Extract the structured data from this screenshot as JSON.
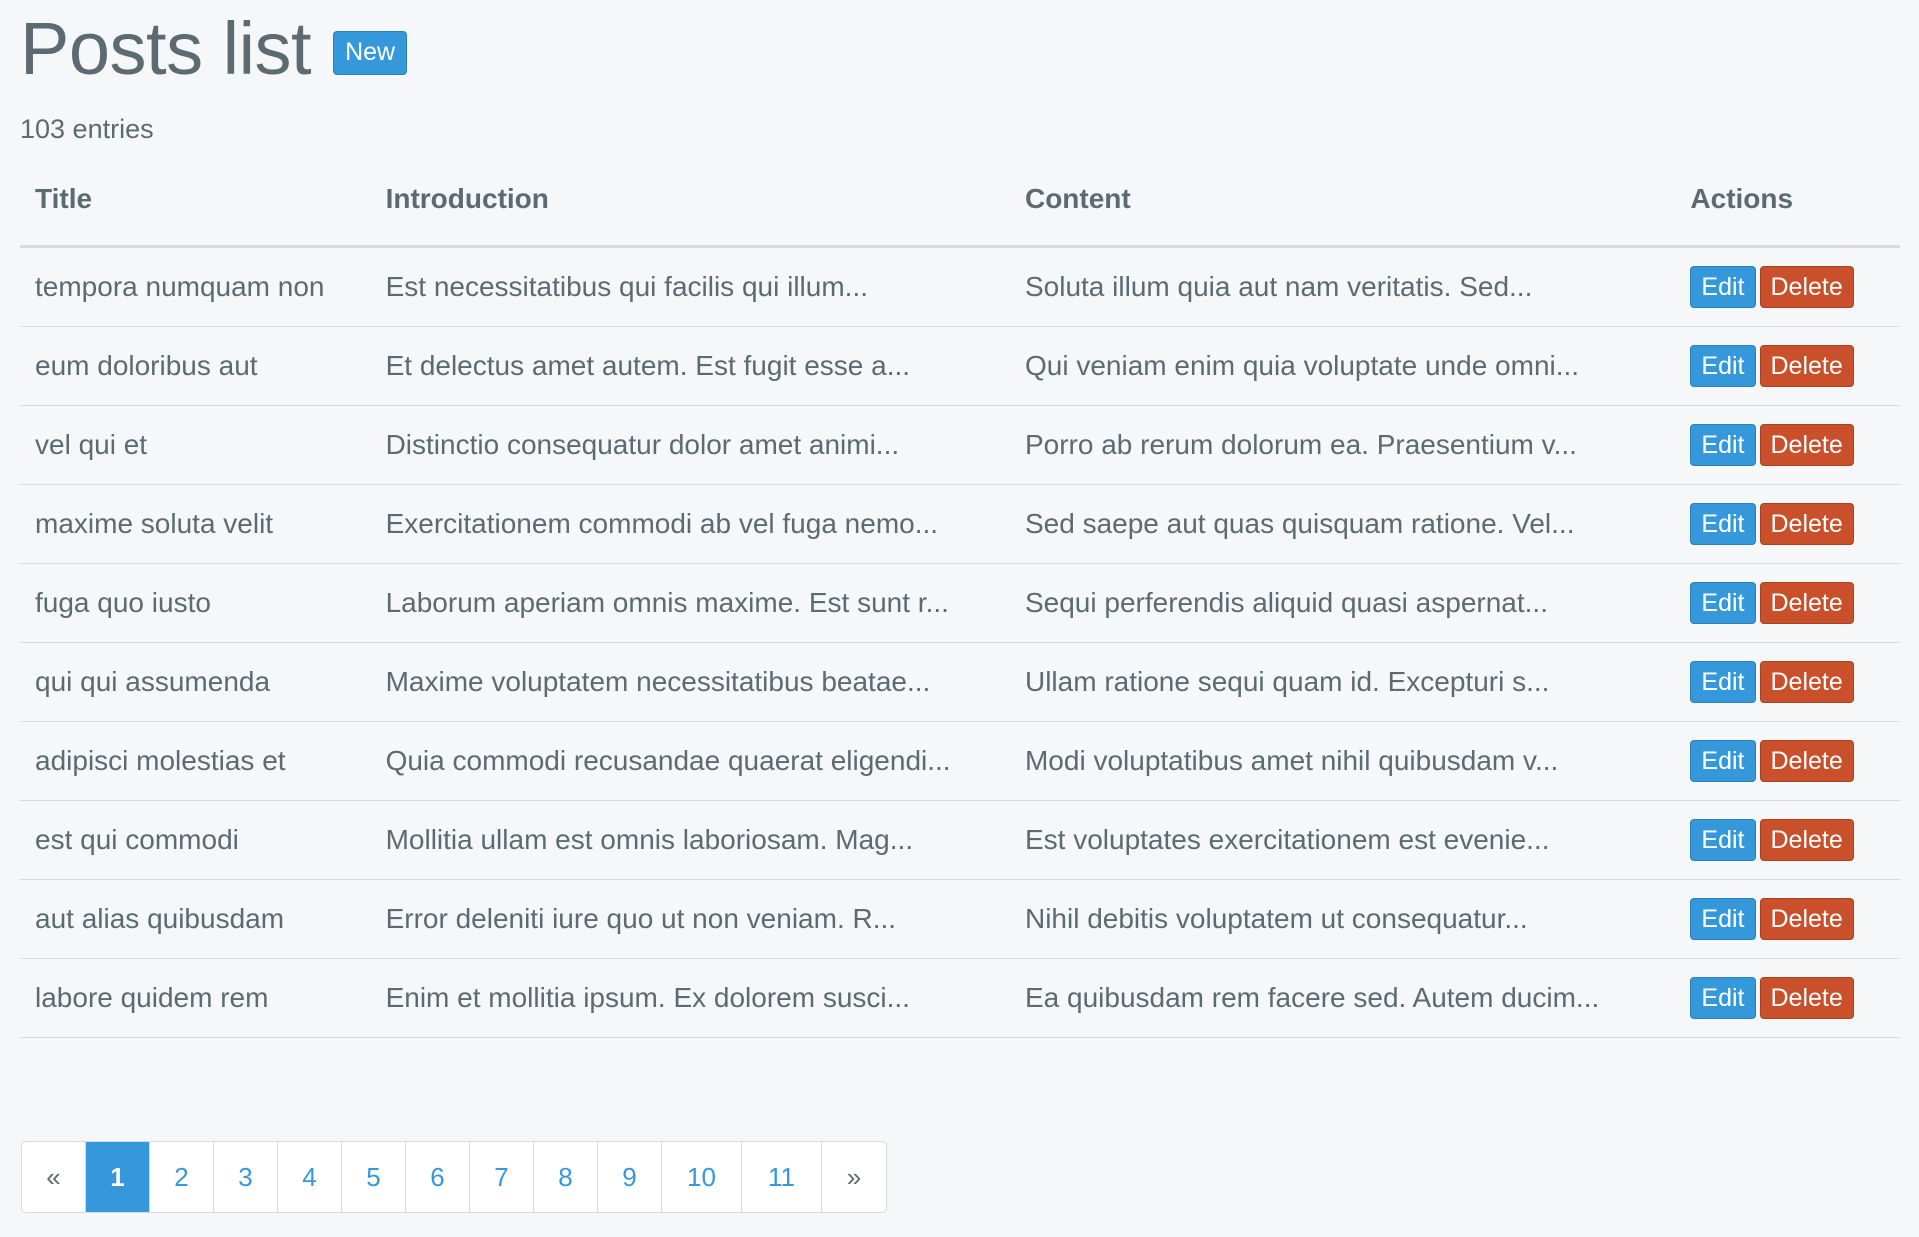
{
  "header": {
    "title": "Posts list",
    "new_label": "New"
  },
  "summary": {
    "entries_text": "103 entries"
  },
  "table": {
    "columns": [
      "Title",
      "Introduction",
      "Content",
      "Actions"
    ],
    "edit_label": "Edit",
    "delete_label": "Delete",
    "rows": [
      {
        "title": "tempora numquam non",
        "introduction": "Est necessitatibus qui facilis qui illum...",
        "content": "Soluta illum quia aut nam veritatis. Sed..."
      },
      {
        "title": "eum doloribus aut",
        "introduction": "Et delectus amet autem. Est fugit esse a...",
        "content": "Qui veniam enim quia voluptate unde omni..."
      },
      {
        "title": "vel qui et",
        "introduction": "Distinctio consequatur dolor amet animi...",
        "content": "Porro ab rerum dolorum ea. Praesentium v..."
      },
      {
        "title": "maxime soluta velit",
        "introduction": "Exercitationem commodi ab vel fuga nemo...",
        "content": "Sed saepe aut quas quisquam ratione. Vel..."
      },
      {
        "title": "fuga quo iusto",
        "introduction": "Laborum aperiam omnis maxime. Est sunt r...",
        "content": "Sequi perferendis aliquid quasi aspernat..."
      },
      {
        "title": "qui qui assumenda",
        "introduction": "Maxime voluptatem necessitatibus beatae...",
        "content": "Ullam ratione sequi quam id. Excepturi s..."
      },
      {
        "title": "adipisci molestias et",
        "introduction": "Quia commodi recusandae quaerat eligendi...",
        "content": "Modi voluptatibus amet nihil quibusdam v..."
      },
      {
        "title": "est qui commodi",
        "introduction": "Mollitia ullam est omnis laboriosam. Mag...",
        "content": "Est voluptates exercitationem est evenie..."
      },
      {
        "title": "aut alias quibusdam",
        "introduction": "Error deleniti iure quo ut non veniam. R...",
        "content": "Nihil debitis voluptatem ut consequatur..."
      },
      {
        "title": "labore quidem rem",
        "introduction": "Enim et mollitia ipsum. Ex dolorem susci...",
        "content": "Ea quibusdam rem facere sed. Autem ducim..."
      }
    ]
  },
  "pagination": {
    "prev_label": "«",
    "next_label": "»",
    "pages": [
      "1",
      "2",
      "3",
      "4",
      "5",
      "6",
      "7",
      "8",
      "9",
      "10",
      "11"
    ],
    "current": "1"
  },
  "colors": {
    "background": "#f6f7f8",
    "text": "#5c6a72",
    "primary": "#3498db",
    "danger": "#c9502a",
    "border": "#d6dbdf"
  }
}
